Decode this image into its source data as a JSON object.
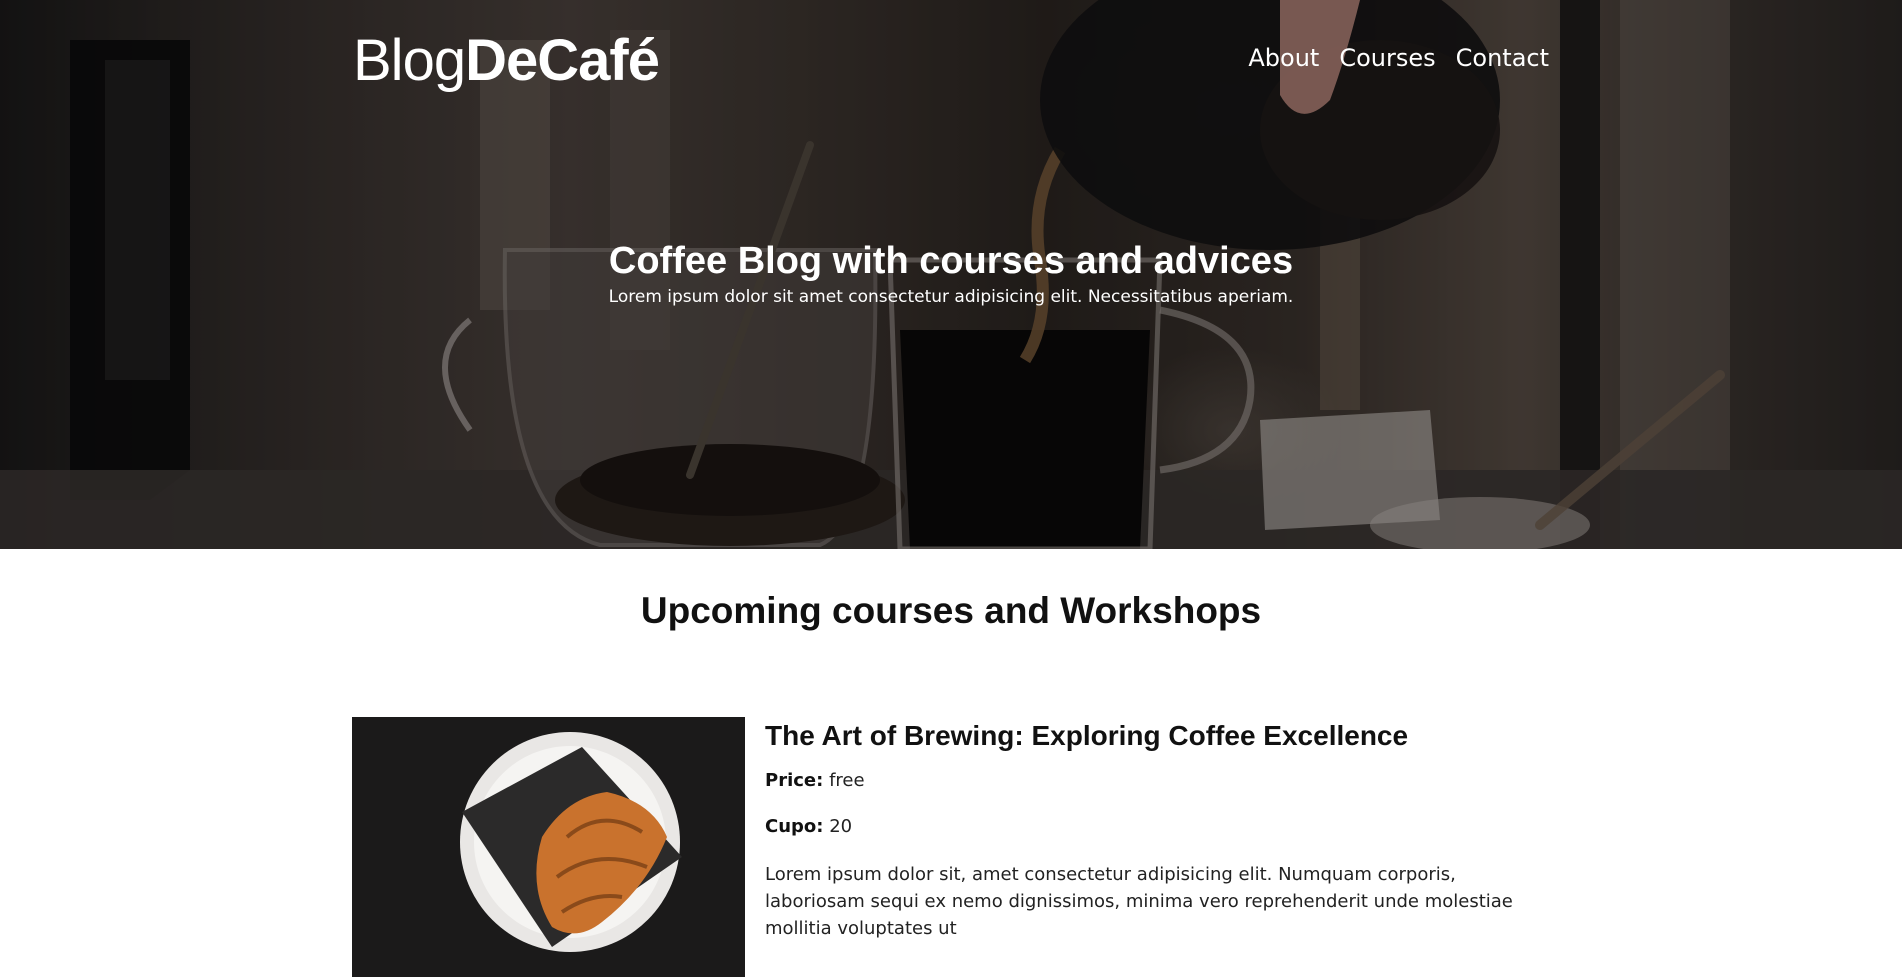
{
  "site": {
    "logo_light": "Blog",
    "logo_bold": "DeCafé"
  },
  "nav": {
    "items": [
      "About",
      "Courses",
      "Contact"
    ]
  },
  "hero": {
    "title": "Coffee Blog with courses and advices",
    "subtitle": "Lorem ipsum dolor sit amet consectetur adipisicing elit. Necessitatibus aperiam."
  },
  "section": {
    "title": "Upcoming courses and Workshops"
  },
  "courses": [
    {
      "title": "The Art of Brewing: Exploring Coffee Excellence",
      "price_label": "Price:",
      "price_value": "free",
      "cupo_label": "Cupo:",
      "cupo_value": "20",
      "description": "Lorem ipsum dolor sit, amet consectetur adipisicing elit. Numquam corporis, laboriosam sequi ex nemo dignissimos, minima vero reprehenderit unde molestiae mollitia voluptates ut"
    }
  ],
  "icons": {
    "hero_image": "coffee-pour-photo",
    "course_image": "croissant-photo"
  },
  "colors": {
    "hero_text": "#ffffff",
    "body_text": "#111111",
    "background": "#ffffff"
  }
}
